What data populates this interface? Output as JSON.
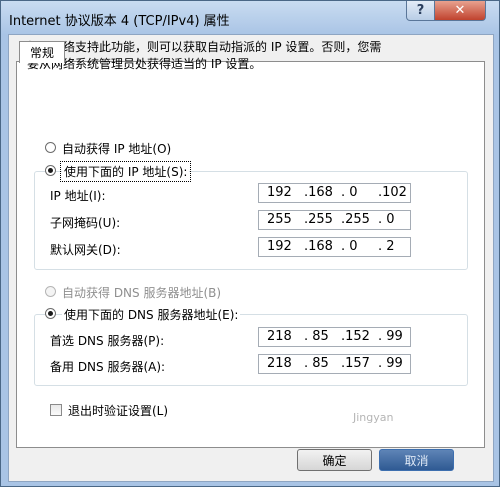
{
  "window": {
    "title": "Internet 协议版本 4 (TCP/IPv4) 属性",
    "help_label": "?",
    "close_label": "✕"
  },
  "tabs": [
    {
      "label": "常规"
    }
  ],
  "description_line1": "如果网络支持此功能，则可以获取自动指派的 IP 设置。否则，您需",
  "description_line2": "要从网络系统管理员处获得适当的 IP 设置。",
  "ip_mode": {
    "auto_label": "自动获得 IP 地址(O)",
    "manual_label": "使用下面的 IP 地址(S):",
    "selected": "manual"
  },
  "ip_fields": [
    {
      "label": "IP 地址(I):",
      "octets": [
        "192",
        ".168",
        ".  0",
        ".102"
      ]
    },
    {
      "label": "子网掩码(U):",
      "octets": [
        "255",
        ".255",
        ".255",
        ".  0"
      ]
    },
    {
      "label": "默认网关(D):",
      "octets": [
        "192",
        ".168",
        ".  0",
        ".  2"
      ]
    }
  ],
  "dns_mode": {
    "auto_label": "自动获得 DNS 服务器地址(B)",
    "manual_label": "使用下面的 DNS 服务器地址(E):",
    "selected": "manual"
  },
  "dns_fields": [
    {
      "label": "首选 DNS 服务器(P):",
      "octets": [
        "218",
        ". 85",
        ".152",
        ". 99"
      ]
    },
    {
      "label": "备用 DNS 服务器(A):",
      "octets": [
        "218",
        ". 85",
        ".157",
        ". 99"
      ]
    }
  ],
  "validate_on_exit": {
    "label": "退出时验证设置(L)",
    "checked": false
  },
  "buttons": {
    "ok": "确定",
    "cancel": "取消"
  },
  "watermark": "Jingyan",
  "colors": {
    "title_bar": "#a9c4e5",
    "close_button": "#c0432e",
    "page": "#ffffff"
  }
}
